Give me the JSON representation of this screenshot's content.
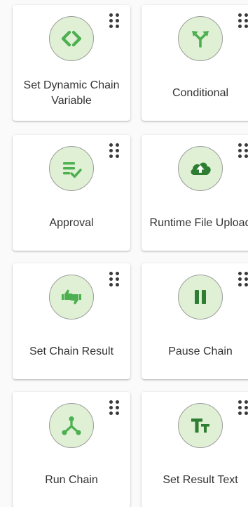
{
  "accent_color": "#4caf50",
  "icon_bg_color": "#dff0d4",
  "cards": [
    {
      "label": "Set Dynamic Chain Variable",
      "icon": "code-brackets-icon"
    },
    {
      "label": "Conditional",
      "icon": "fork-arrows-icon"
    },
    {
      "label": "Approval",
      "icon": "list-check-icon"
    },
    {
      "label": "Runtime File Upload",
      "icon": "cloud-upload-icon"
    },
    {
      "label": "Set Chain Result",
      "icon": "thumbs-up-down-icon"
    },
    {
      "label": "Pause Chain",
      "icon": "pause-icon"
    },
    {
      "label": "Run Chain",
      "icon": "branch-nodes-icon"
    },
    {
      "label": "Set Result Text",
      "icon": "text-size-icon"
    }
  ]
}
